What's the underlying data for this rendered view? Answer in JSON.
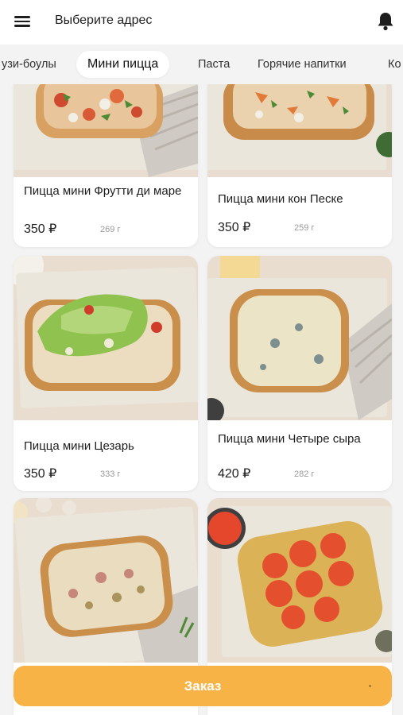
{
  "header": {
    "address_label": "Выберите адрес"
  },
  "tabs": [
    {
      "label": "узи-боулы",
      "active": false
    },
    {
      "label": "Мини пицца",
      "active": true
    },
    {
      "label": "Паста",
      "active": false
    },
    {
      "label": "Горячие напитки",
      "active": false
    },
    {
      "label": "Ко",
      "active": false
    }
  ],
  "products": [
    {
      "name": "Пицца мини Фрутти ди маре",
      "price": "350 ₽",
      "weight": "269 г"
    },
    {
      "name": "Пицца мини кон Песке",
      "price": "350 ₽",
      "weight": "259 г"
    },
    {
      "name": "Пицца мини Цезарь",
      "price": "350 ₽",
      "weight": "333 г"
    },
    {
      "name": "Пицца мини Четыре сыра",
      "price": "420 ₽",
      "weight": "282 г"
    },
    {
      "name": "",
      "price": "",
      "weight": ""
    },
    {
      "name": "",
      "price": "",
      "weight": ""
    }
  ],
  "order_button": {
    "label": "Заказ"
  },
  "colors": {
    "accent": "#f7b346",
    "background": "#f3f3f3",
    "card": "#ffffff"
  }
}
